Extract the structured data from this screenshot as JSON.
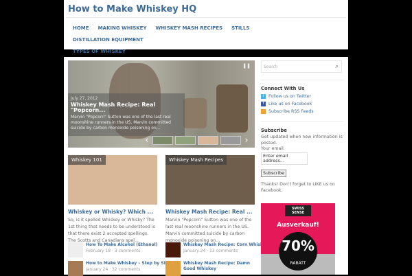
{
  "site_title": "How to Make Whiskey HQ",
  "nav": [
    "HOME",
    "MAKING WHISKEY",
    "WHISKEY MASH RECIPES",
    "STILLS",
    "DISTILLATION EQUIPMENT",
    "TYPES OF WHISKEY"
  ],
  "slider": {
    "date": "July 27, 2012",
    "title": "Whiskey Mash Recipe: Real \"Popcorn...",
    "excerpt": "Marvin \"Popcorn\" Sutton was one of the last real moonshine runners in the US. Marvin committed suicide by carbon monoxide poisoning on..."
  },
  "cards": [
    {
      "label": "Whiskey 101",
      "title": "Whiskey or Whisky? Which ...",
      "excerpt": "So, is it spelled Whiskey or Whisky? The 1st thing that needs to be understood is that there exist 2 accepted spellings. The Scotts and Canadians spel..."
    },
    {
      "label": "Whiskey Mash Recipes",
      "title": "Whiskey Mash Recipe: Real ...",
      "excerpt": "Marvin \"Popcorn\" Sutton was one of the last real moonshine runners in the US. Marvin committed suicide by carbon monoxide poisoning on..."
    }
  ],
  "lists": [
    [
      {
        "title": "How To Make Alcohol (Ethanol)",
        "date": "February 18",
        "comments": "3 comments"
      },
      {
        "title": "How to Make Whiskey – Step by Step",
        "date": "January 24",
        "comments": "32 comments"
      }
    ],
    [
      {
        "title": "Whiskey Mash Recipe: Corn Whiskey",
        "date": "January 24",
        "comments": "13 comments"
      },
      {
        "title": "Whiskey Mash Recipe: Damn Good Whiskey",
        "date": "",
        "comments": ""
      }
    ]
  ],
  "sidebar": {
    "search_placeholder": "Search",
    "connect_title": "Connect With Us",
    "links": [
      "Follow us on Twitter",
      "Like us on Facebook",
      "Subscribe RSS Feeds"
    ],
    "subscribe_title": "Subscribe",
    "subscribe_text": "Get updated when new information is posted.",
    "email_label": "Your email:",
    "email_placeholder": "Enter email address...",
    "subscribe_btn": "Subscribe",
    "thanks": "Thanks! Don't forget to LIKE us on Facebook."
  },
  "ad": {
    "brand": "SWISS SENSE",
    "headline": "Ausverkauf!",
    "discount": "70%",
    "discount_label": "RABATT"
  }
}
